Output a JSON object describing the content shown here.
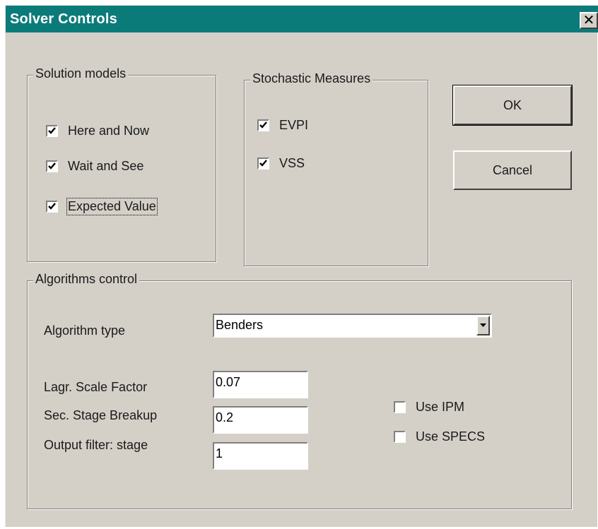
{
  "window": {
    "title": "Solver Controls",
    "close_icon": "close-icon",
    "title_color": "#0b7b7a"
  },
  "solution_models": {
    "label": "Solution models",
    "items": [
      {
        "label": "Here and Now",
        "checked": true
      },
      {
        "label": "Wait and See",
        "checked": true
      },
      {
        "label": "Expected Value",
        "checked": true
      }
    ]
  },
  "stochastic_measures": {
    "label": "Stochastic Measures",
    "items": [
      {
        "label": "EVPI",
        "checked": true
      },
      {
        "label": "VSS",
        "checked": true
      }
    ]
  },
  "buttons": {
    "ok": "OK",
    "cancel": "Cancel"
  },
  "algorithms": {
    "label": "Algorithms control",
    "type_label": "Algorithm type",
    "type_value": "Benders",
    "fields": [
      {
        "label": "Lagr. Scale Factor",
        "value": "0.07"
      },
      {
        "label": "Sec. Stage Breakup",
        "value": "0.2"
      },
      {
        "label": "Output filter: stage",
        "value": "1"
      }
    ],
    "options": [
      {
        "label": "Use IPM",
        "checked": false
      },
      {
        "label": "Use SPECS",
        "checked": false
      }
    ]
  }
}
